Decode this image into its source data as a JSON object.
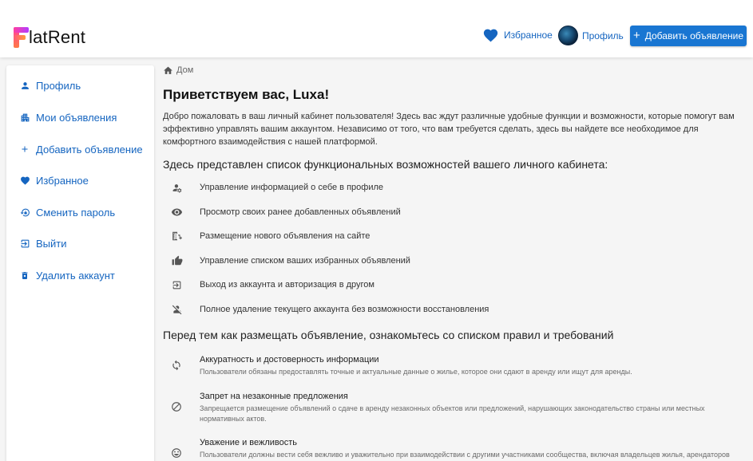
{
  "header": {
    "logo_text": "latRent",
    "favorites_label": "Избранное",
    "profile_label": "Профиль",
    "add_button_label": "Добавить объявление",
    "brand_color": "#1976d2"
  },
  "sidebar": {
    "items": [
      {
        "label": "Профиль",
        "icon": "person-icon"
      },
      {
        "label": "Мои объявления",
        "icon": "apartment-icon"
      },
      {
        "label": "Добавить объявление",
        "icon": "plus-icon"
      },
      {
        "label": "Избранное",
        "icon": "heart-icon"
      },
      {
        "label": "Сменить пароль",
        "icon": "lock-reset-icon"
      },
      {
        "label": "Выйти",
        "icon": "logout-icon"
      },
      {
        "label": "Удалить аккаунт",
        "icon": "trash-icon"
      }
    ]
  },
  "main": {
    "breadcrumb": "Дом",
    "title": "Приветствуем вас, Luxa!",
    "intro": "Добро пожаловать в ваш личный кабинет пользователя! Здесь вас ждут различные удобные функции и возможности, которые помогут вам эффективно управлять вашим аккаунтом. Независимо от того, что вам требуется сделать, здесь вы найдете все необходимое для комфортного взаимодействия с нашей платформой.",
    "features_title": "Здесь представлен список функциональных возможностей вашего личного кабинета:",
    "features": [
      {
        "text": "Управление информацией о себе в профиле",
        "icon": "manage-account-icon"
      },
      {
        "text": "Просмотр своих ранее добавленных объявлений",
        "icon": "eye-icon"
      },
      {
        "text": "Размещение нового объявления на сайте",
        "icon": "add-building-icon"
      },
      {
        "text": "Управление списком ваших избранных объявлений",
        "icon": "thumb-up-icon"
      },
      {
        "text": "Выход из аккаунта и авторизация в другом",
        "icon": "exit-icon"
      },
      {
        "text": "Полное удаление текущего аккаунта без возможности восстановления",
        "icon": "person-off-icon"
      }
    ],
    "rules_title": "Перед тем как размещать объявление, ознакомьтесь со списком правил и требований",
    "rules": [
      {
        "title": "Аккуратность и достоверность информации",
        "desc": "Пользователи обязаны предоставлять точные и актуальные данные о жилье, которое они сдают в аренду или ищут для аренды.",
        "icon": "sync-icon"
      },
      {
        "title": "Запрет на незаконные предложения",
        "desc": "Запрещается размещение объявлений о сдаче в аренду незаконных объектов или предложений, нарушающих законодательство страны или местных нормативных актов.",
        "icon": "block-icon"
      },
      {
        "title": "Уважение и вежливость",
        "desc": "Пользователи должны вести себя вежливо и уважительно при взаимодействии с другими участниками сообщества, включая владельцев жилья, арендаторов",
        "icon": "smile-icon"
      }
    ]
  }
}
